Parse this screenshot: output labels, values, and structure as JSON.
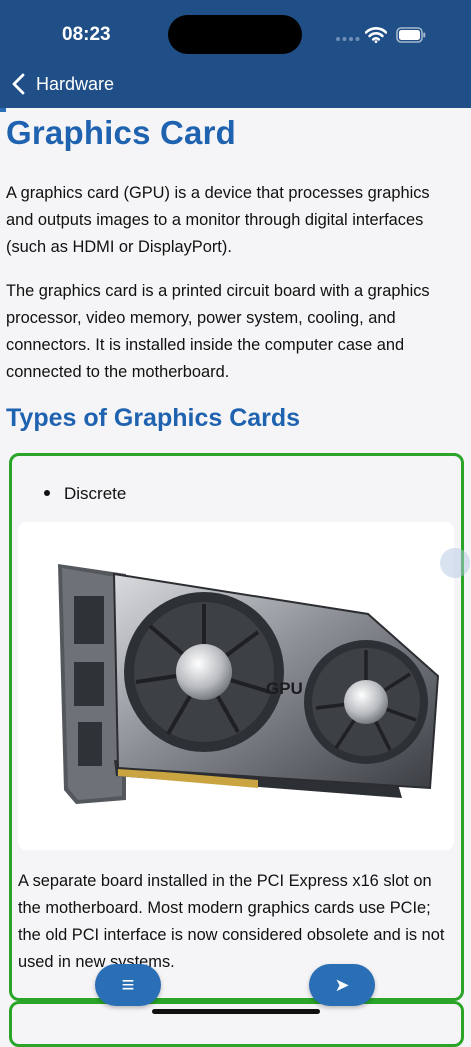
{
  "status": {
    "time": "08:23"
  },
  "nav": {
    "back_label": "Hardware"
  },
  "article": {
    "title": "Graphics Card",
    "para1": "A graphics card (GPU) is a device that processes graphics and outputs images to a monitor through digital interfaces (such as HDMI or DisplayPort).",
    "para2": "The graphics card is a printed circuit board with a graphics processor, video memory, power system, cooling, and connectors. It is installed inside the computer case and connected to the motherboard.",
    "section_title": "Types of Graphics Cards"
  },
  "card": {
    "bullet": "Discrete",
    "image_label": "GPU",
    "description": "A separate board installed in the PCI Express x16 slot on the motherboard. Most modern graphics cards use PCIe; the old PCI interface is now considered obsolete and is not used in new systems."
  },
  "buttons": {
    "menu_glyph": "≡",
    "next_glyph": "➤"
  },
  "colors": {
    "header": "#1f4f86",
    "title": "#1f63b0",
    "card_border": "#2aa52a",
    "fab": "#2a6fb6"
  }
}
